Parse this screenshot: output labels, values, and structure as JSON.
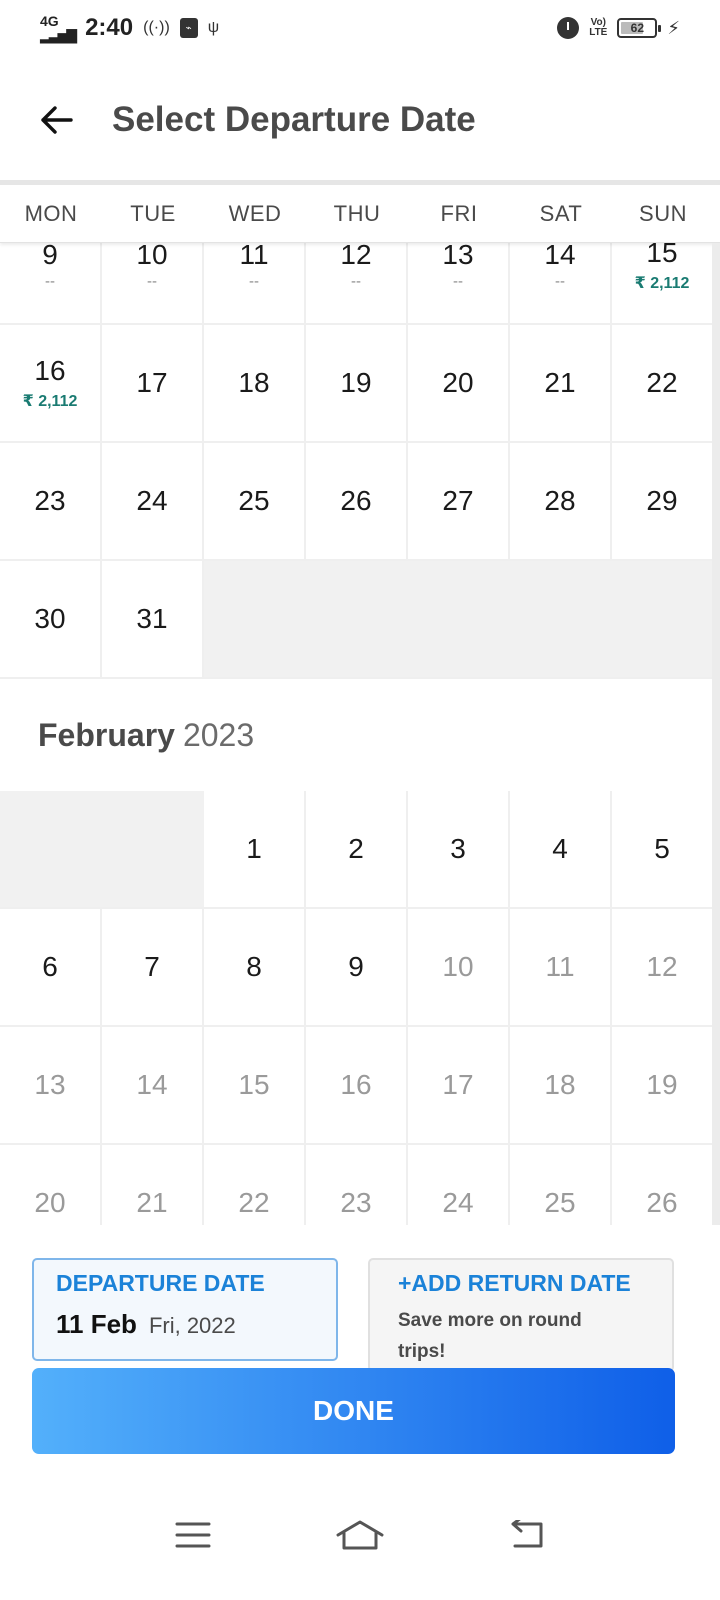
{
  "status_bar": {
    "network": "4G",
    "time": "2:40",
    "battery": "62"
  },
  "header": {
    "title": "Select Departure Date"
  },
  "weekdays": [
    "MON",
    "TUE",
    "WED",
    "THU",
    "FRI",
    "SAT",
    "SUN"
  ],
  "january": {
    "rows": [
      [
        {
          "num": "9",
          "sub": "--"
        },
        {
          "num": "10",
          "sub": "--"
        },
        {
          "num": "11",
          "sub": "--"
        },
        {
          "num": "12",
          "sub": "--"
        },
        {
          "num": "13",
          "sub": "--"
        },
        {
          "num": "14",
          "sub": "--"
        },
        {
          "num": "15",
          "price": "₹ 2,112"
        }
      ],
      [
        {
          "num": "16",
          "price": "₹ 2,112"
        },
        {
          "num": "17"
        },
        {
          "num": "18"
        },
        {
          "num": "19"
        },
        {
          "num": "20"
        },
        {
          "num": "21"
        },
        {
          "num": "22"
        }
      ],
      [
        {
          "num": "23"
        },
        {
          "num": "24"
        },
        {
          "num": "25"
        },
        {
          "num": "26"
        },
        {
          "num": "27"
        },
        {
          "num": "28"
        },
        {
          "num": "29"
        }
      ],
      [
        {
          "num": "30"
        },
        {
          "num": "31"
        },
        {
          "empty": true
        },
        {
          "empty": true
        },
        {
          "empty": true
        },
        {
          "empty": true
        },
        {
          "empty": true
        }
      ]
    ]
  },
  "february": {
    "month": "February",
    "year": "2023",
    "rows": [
      [
        {
          "empty": true
        },
        {
          "empty": true
        },
        {
          "num": "1"
        },
        {
          "num": "2"
        },
        {
          "num": "3"
        },
        {
          "num": "4"
        },
        {
          "num": "5"
        }
      ],
      [
        {
          "num": "6"
        },
        {
          "num": "7"
        },
        {
          "num": "8"
        },
        {
          "num": "9"
        },
        {
          "num": "10",
          "disabled": true
        },
        {
          "num": "11",
          "disabled": true
        },
        {
          "num": "12",
          "disabled": true
        }
      ],
      [
        {
          "num": "13",
          "disabled": true
        },
        {
          "num": "14",
          "disabled": true
        },
        {
          "num": "15",
          "disabled": true
        },
        {
          "num": "16",
          "disabled": true
        },
        {
          "num": "17",
          "disabled": true
        },
        {
          "num": "18",
          "disabled": true
        },
        {
          "num": "19",
          "disabled": true
        }
      ],
      [
        {
          "num": "20",
          "disabled": true
        },
        {
          "num": "21",
          "disabled": true
        },
        {
          "num": "22",
          "disabled": true
        },
        {
          "num": "23",
          "disabled": true
        },
        {
          "num": "24",
          "disabled": true
        },
        {
          "num": "25",
          "disabled": true
        },
        {
          "num": "26",
          "disabled": true
        }
      ]
    ]
  },
  "departure_card": {
    "label": "DEPARTURE DATE",
    "date": "11 Feb",
    "weekday_year": "Fri, 2022"
  },
  "return_card": {
    "label": "+ADD RETURN DATE",
    "note": "Save more on round trips!"
  },
  "done_button": {
    "label": "DONE"
  },
  "colors": {
    "accent": "#1b82d8",
    "price": "#1a7b72",
    "button_start": "#53b0fb",
    "button_end": "#0f5fe8"
  },
  "icons": {
    "back": "arrow-left-icon",
    "nav_menu": "menu-icon",
    "nav_home": "home-icon",
    "nav_back": "back-icon"
  }
}
